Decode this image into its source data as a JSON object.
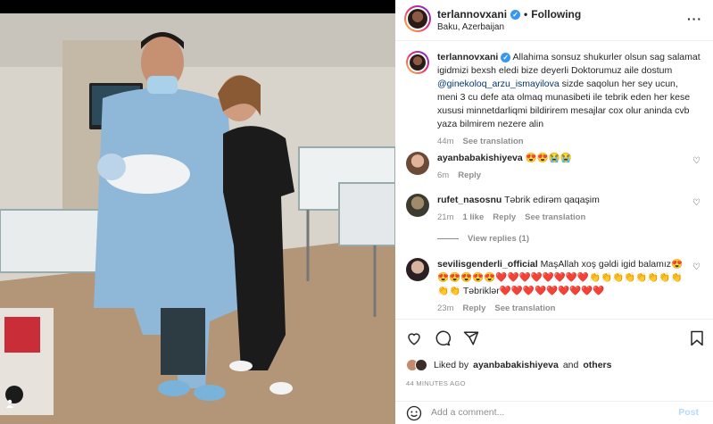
{
  "post": {
    "username": "terlannovxani",
    "follow_label": "Following",
    "location": "Baku, Azerbaijan",
    "more_label": "···"
  },
  "caption": {
    "username": "terlannovxani",
    "text_before": "Allahima sonsuz shukurler olsun sag salamat igidmizi bexsh eledi bize deyerli Doktorumuz aile dostum ",
    "mention": "@ginekoloq_arzu_ismayilova",
    "text_after": " sizde saqolun her sey ucun, meni 3 cu defe ata olmaq munasibeti ile tebrik eden her kese xususi minnetdarliqmi bildirirem mesajlar cox olur aninda cvb yaza bilmirem nezere alin",
    "time": "44m",
    "see_translation": "See translation"
  },
  "comments": [
    {
      "username": "ayanbabakishiyeva",
      "text": "😍😍😭😭",
      "time": "6m",
      "reply": "Reply"
    },
    {
      "username": "rufet_nasosnu",
      "text": "Təbrik edirəm qaqaşim",
      "time": "21m",
      "likes": "1 like",
      "reply": "Reply",
      "see_translation": "See translation",
      "view_replies": "View replies (1)"
    },
    {
      "username": "sevilisgenderli_official",
      "text": "MaşAllah xoş gəldi igid balamız😍😍😍😍😍😍❤️❤️❤️❤️❤️❤️❤️❤️👏👏👏👏👏👏👏👏👏👏 Təbriklər❤️❤️❤️❤️❤️❤️❤️❤️❤️",
      "time": "23m",
      "reply": "Reply",
      "see_translation": "See translation"
    }
  ],
  "likes": {
    "prefix": "Liked by",
    "user": "ayanbabakishiyeva",
    "and": "and",
    "others": "others"
  },
  "timestamp": "44 MINUTES AGO",
  "add_comment": {
    "placeholder": "Add a comment...",
    "post_label": "Post"
  },
  "colors": {
    "accent": "#0095f6",
    "link": "#00376b",
    "muted": "#8e8e8e"
  }
}
